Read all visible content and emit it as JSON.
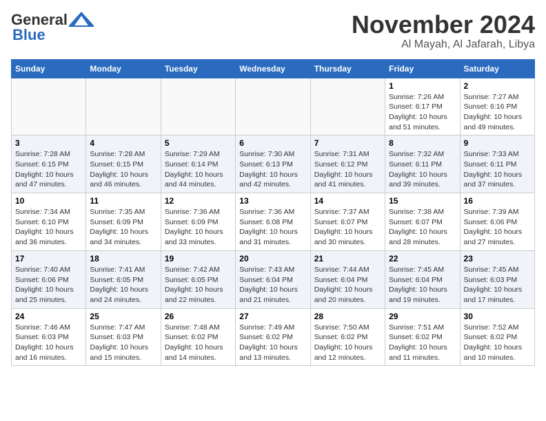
{
  "header": {
    "logo_line1": "General",
    "logo_line2": "Blue",
    "month": "November 2024",
    "location": "Al Mayah, Al Jafarah, Libya"
  },
  "weekdays": [
    "Sunday",
    "Monday",
    "Tuesday",
    "Wednesday",
    "Thursday",
    "Friday",
    "Saturday"
  ],
  "weeks": [
    [
      {
        "day": "",
        "info": ""
      },
      {
        "day": "",
        "info": ""
      },
      {
        "day": "",
        "info": ""
      },
      {
        "day": "",
        "info": ""
      },
      {
        "day": "",
        "info": ""
      },
      {
        "day": "1",
        "info": "Sunrise: 7:26 AM\nSunset: 6:17 PM\nDaylight: 10 hours\nand 51 minutes."
      },
      {
        "day": "2",
        "info": "Sunrise: 7:27 AM\nSunset: 6:16 PM\nDaylight: 10 hours\nand 49 minutes."
      }
    ],
    [
      {
        "day": "3",
        "info": "Sunrise: 7:28 AM\nSunset: 6:15 PM\nDaylight: 10 hours\nand 47 minutes."
      },
      {
        "day": "4",
        "info": "Sunrise: 7:28 AM\nSunset: 6:15 PM\nDaylight: 10 hours\nand 46 minutes."
      },
      {
        "day": "5",
        "info": "Sunrise: 7:29 AM\nSunset: 6:14 PM\nDaylight: 10 hours\nand 44 minutes."
      },
      {
        "day": "6",
        "info": "Sunrise: 7:30 AM\nSunset: 6:13 PM\nDaylight: 10 hours\nand 42 minutes."
      },
      {
        "day": "7",
        "info": "Sunrise: 7:31 AM\nSunset: 6:12 PM\nDaylight: 10 hours\nand 41 minutes."
      },
      {
        "day": "8",
        "info": "Sunrise: 7:32 AM\nSunset: 6:11 PM\nDaylight: 10 hours\nand 39 minutes."
      },
      {
        "day": "9",
        "info": "Sunrise: 7:33 AM\nSunset: 6:11 PM\nDaylight: 10 hours\nand 37 minutes."
      }
    ],
    [
      {
        "day": "10",
        "info": "Sunrise: 7:34 AM\nSunset: 6:10 PM\nDaylight: 10 hours\nand 36 minutes."
      },
      {
        "day": "11",
        "info": "Sunrise: 7:35 AM\nSunset: 6:09 PM\nDaylight: 10 hours\nand 34 minutes."
      },
      {
        "day": "12",
        "info": "Sunrise: 7:36 AM\nSunset: 6:09 PM\nDaylight: 10 hours\nand 33 minutes."
      },
      {
        "day": "13",
        "info": "Sunrise: 7:36 AM\nSunset: 6:08 PM\nDaylight: 10 hours\nand 31 minutes."
      },
      {
        "day": "14",
        "info": "Sunrise: 7:37 AM\nSunset: 6:07 PM\nDaylight: 10 hours\nand 30 minutes."
      },
      {
        "day": "15",
        "info": "Sunrise: 7:38 AM\nSunset: 6:07 PM\nDaylight: 10 hours\nand 28 minutes."
      },
      {
        "day": "16",
        "info": "Sunrise: 7:39 AM\nSunset: 6:06 PM\nDaylight: 10 hours\nand 27 minutes."
      }
    ],
    [
      {
        "day": "17",
        "info": "Sunrise: 7:40 AM\nSunset: 6:06 PM\nDaylight: 10 hours\nand 25 minutes."
      },
      {
        "day": "18",
        "info": "Sunrise: 7:41 AM\nSunset: 6:05 PM\nDaylight: 10 hours\nand 24 minutes."
      },
      {
        "day": "19",
        "info": "Sunrise: 7:42 AM\nSunset: 6:05 PM\nDaylight: 10 hours\nand 22 minutes."
      },
      {
        "day": "20",
        "info": "Sunrise: 7:43 AM\nSunset: 6:04 PM\nDaylight: 10 hours\nand 21 minutes."
      },
      {
        "day": "21",
        "info": "Sunrise: 7:44 AM\nSunset: 6:04 PM\nDaylight: 10 hours\nand 20 minutes."
      },
      {
        "day": "22",
        "info": "Sunrise: 7:45 AM\nSunset: 6:04 PM\nDaylight: 10 hours\nand 19 minutes."
      },
      {
        "day": "23",
        "info": "Sunrise: 7:45 AM\nSunset: 6:03 PM\nDaylight: 10 hours\nand 17 minutes."
      }
    ],
    [
      {
        "day": "24",
        "info": "Sunrise: 7:46 AM\nSunset: 6:03 PM\nDaylight: 10 hours\nand 16 minutes."
      },
      {
        "day": "25",
        "info": "Sunrise: 7:47 AM\nSunset: 6:03 PM\nDaylight: 10 hours\nand 15 minutes."
      },
      {
        "day": "26",
        "info": "Sunrise: 7:48 AM\nSunset: 6:02 PM\nDaylight: 10 hours\nand 14 minutes."
      },
      {
        "day": "27",
        "info": "Sunrise: 7:49 AM\nSunset: 6:02 PM\nDaylight: 10 hours\nand 13 minutes."
      },
      {
        "day": "28",
        "info": "Sunrise: 7:50 AM\nSunset: 6:02 PM\nDaylight: 10 hours\nand 12 minutes."
      },
      {
        "day": "29",
        "info": "Sunrise: 7:51 AM\nSunset: 6:02 PM\nDaylight: 10 hours\nand 11 minutes."
      },
      {
        "day": "30",
        "info": "Sunrise: 7:52 AM\nSunset: 6:02 PM\nDaylight: 10 hours\nand 10 minutes."
      }
    ]
  ]
}
